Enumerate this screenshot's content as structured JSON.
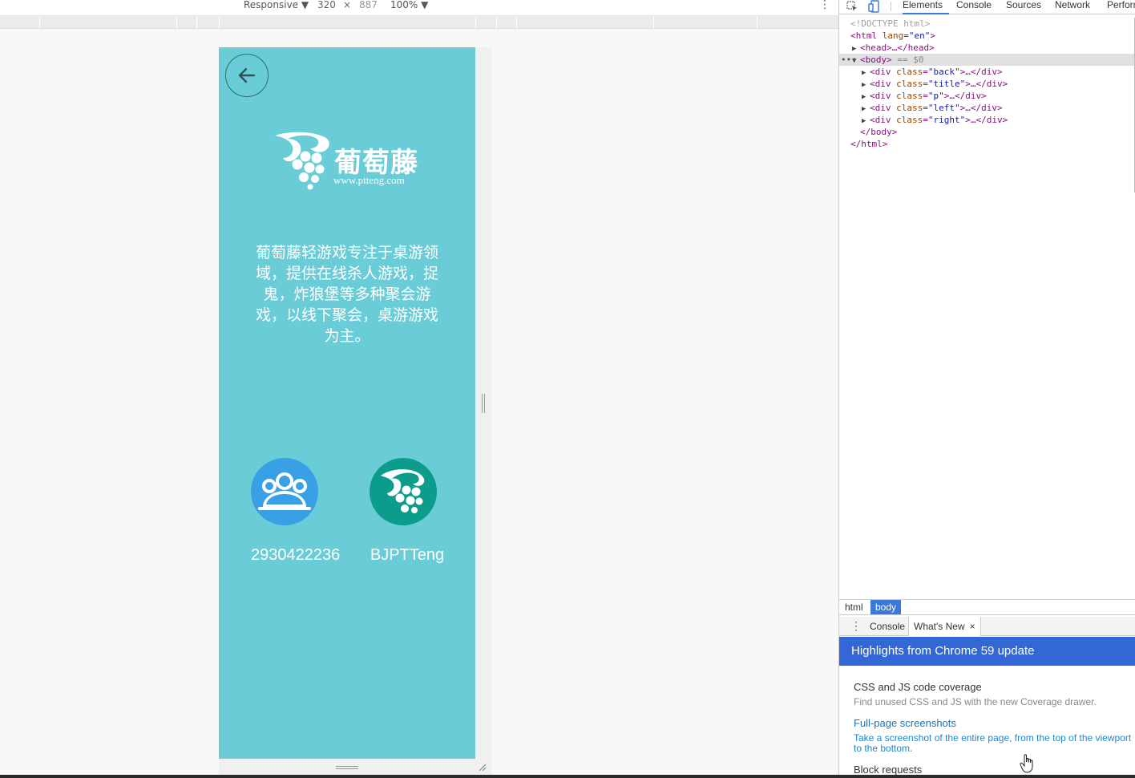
{
  "device_toolbar": {
    "mode": "Responsive",
    "width": "320",
    "times": "×",
    "height": "887",
    "zoom": "100%",
    "more": "⋮"
  },
  "page": {
    "logo_text": "葡萄藤",
    "logo_url": "www.ptteng.com",
    "intro": "葡萄藤轻游戏专注于桌游领域，提供在线杀人游戏，捉鬼，炸狼堡等多种聚会游戏，以线下聚会，桌游游戏为主。",
    "qq_number": "2930422236",
    "wechat_id": "BJPTTeng",
    "colors": {
      "background": "#69ccd6",
      "qq": "#3aa0e6",
      "wechat": "#0c9c8c"
    }
  },
  "devtools": {
    "tabs": [
      "Elements",
      "Console",
      "Sources",
      "Network",
      "Perform"
    ],
    "active_tab": "Elements",
    "dom": {
      "doctype": "<!DOCTYPE html>",
      "html_open": "<html",
      "lang_attr": "lang",
      "lang_val": "\"en\"",
      "html_open_end": ">",
      "head": "<head>…</head>",
      "body_open": "<body>",
      "body_marker": "== $0",
      "class_attr": "class",
      "children": [
        "\"back\"",
        "\"title\"",
        "\"p\"",
        "\"left\"",
        "\"right\""
      ],
      "div_open": "<div",
      "div_close": ">…</div>",
      "body_close": "</body>",
      "html_close": "</html>"
    },
    "breadcrumbs": [
      "html",
      "body"
    ],
    "drawer": {
      "tabs": [
        "Console",
        "What's New"
      ],
      "close": "×",
      "banner": "Highlights from Chrome 59 update",
      "items": [
        {
          "title": "CSS and JS code coverage",
          "desc": "Find unused CSS and JS with the new Coverage drawer."
        },
        {
          "title": "Full-page screenshots",
          "desc": "Take a screenshot of the entire page, from the top of the viewport to the bottom."
        },
        {
          "title": "Block requests"
        }
      ]
    }
  }
}
